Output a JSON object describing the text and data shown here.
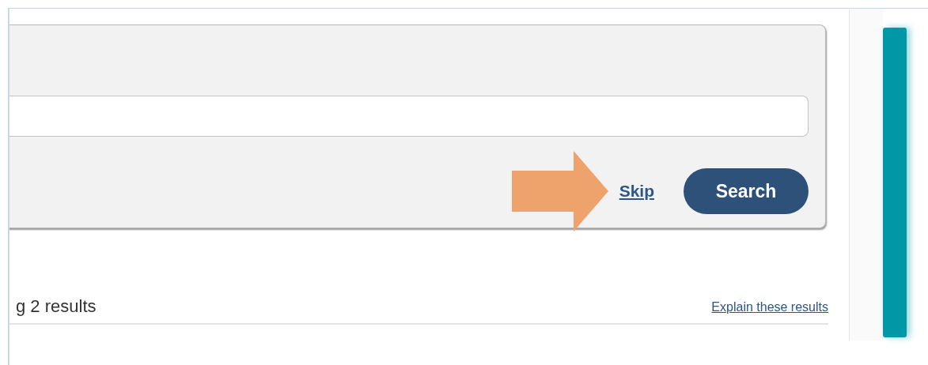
{
  "search_panel": {
    "annotation": {
      "kind": "arrow"
    },
    "skip_link": "Skip",
    "search_button": "Search"
  },
  "results": {
    "summary": "g 2 results",
    "explain_link": "Explain these results"
  }
}
